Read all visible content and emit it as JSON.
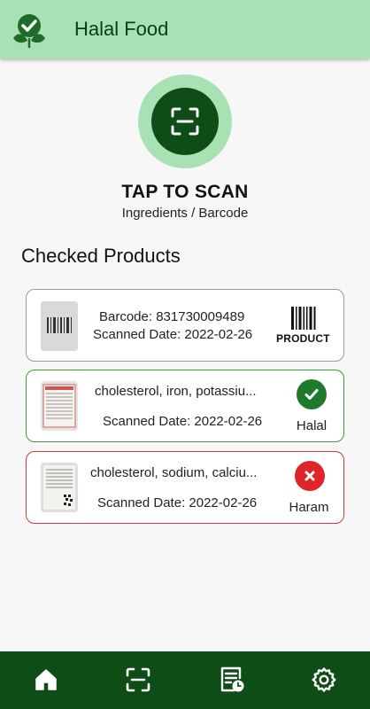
{
  "app": {
    "title": "Halal Food"
  },
  "scan": {
    "title": "TAP TO SCAN",
    "subtitle": "Ingredients / Barcode"
  },
  "checked": {
    "title": "Checked Products",
    "items": [
      {
        "line1": "Barcode: 831730009489",
        "line2": "Scanned Date: 2022-02-26",
        "status_label": "PRODUCT",
        "status_icon": "barcode-icon"
      },
      {
        "line1": "cholesterol, iron, potassiu...",
        "line2": "Scanned Date: 2022-02-26",
        "status_label": "Halal",
        "status_icon": "check-icon",
        "status_color": "#1f7a2e"
      },
      {
        "line1": "cholesterol, sodium, calciu...",
        "line2": "Scanned Date: 2022-02-26",
        "status_label": "Haram",
        "status_icon": "close-icon",
        "status_color": "#e0252a"
      }
    ]
  },
  "nav": {
    "items": [
      "home-icon",
      "scan-icon",
      "history-icon",
      "settings-icon"
    ]
  },
  "colors": {
    "primary_dark": "#0e4d16",
    "primary_light": "#a8e2b4",
    "halal": "#3f9a3f",
    "haram": "#d23b3b"
  }
}
